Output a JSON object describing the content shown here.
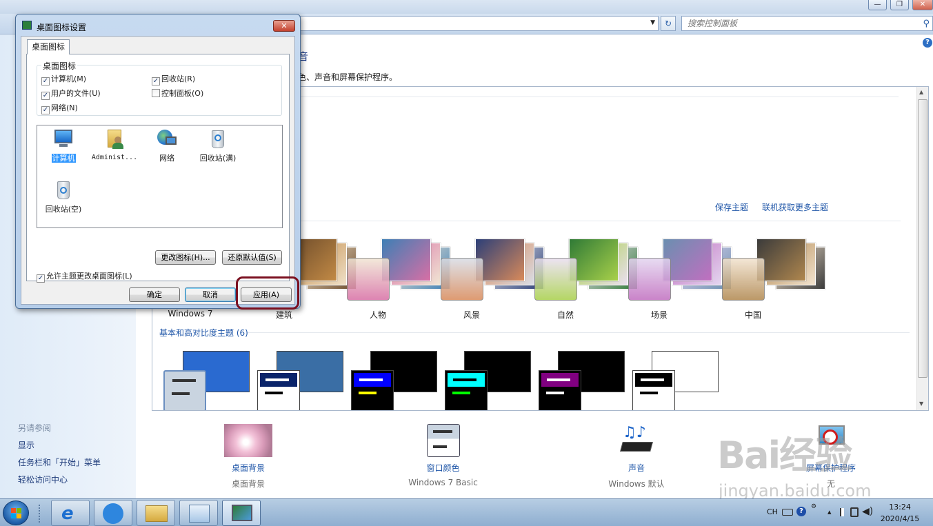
{
  "window": {
    "minimize_glyph": "—",
    "restore_glyph": "❐",
    "close_glyph": "✕",
    "address_dropdown_glyph": "▼",
    "refresh_glyph": "↻",
    "search_placeholder": "搜索控制面板",
    "search_glyph": "⚲",
    "help_glyph": "?"
  },
  "content": {
    "heading_tail": "音",
    "description_tail": "色、声音和屏幕保护程序。",
    "save_theme": "保存主题",
    "get_more_themes": "联机获取更多主题",
    "aero_themes": [
      {
        "name": "Windows 7",
        "colors": [
          "#1d6fd2",
          "#6fb2ef",
          "#dfe9f7"
        ]
      },
      {
        "name": "建筑",
        "colors": [
          "#6b4a2a",
          "#c28a45",
          "#efe0c8"
        ]
      },
      {
        "name": "人物",
        "colors": [
          "#3d7fb5",
          "#d86fa5",
          "#f1e6d4"
        ]
      },
      {
        "name": "风景",
        "colors": [
          "#2c3f78",
          "#d98a5a",
          "#d9dde6"
        ]
      },
      {
        "name": "自然",
        "colors": [
          "#2f7a36",
          "#a8d04a",
          "#eadff0"
        ]
      },
      {
        "name": "场景",
        "colors": [
          "#6a8fb0",
          "#c16fc0",
          "#e4d6f0"
        ]
      },
      {
        "name": "中国",
        "colors": [
          "#3b3b3b",
          "#b0874e",
          "#f2e3cf"
        ]
      }
    ],
    "basic_title": "基本和高对比度主题 (6)",
    "basic_themes": [
      {
        "big": "#2a6ad0",
        "cap": "#c9d4e0",
        "bar1": "#333333",
        "bar2": "#333333",
        "body": "#ffffff",
        "selected": true
      },
      {
        "big": "#3a6ea5",
        "cap": "#0a246a",
        "bar1": "#ffffff",
        "bar2": "#000000",
        "body": "#ffffff",
        "selected": false
      },
      {
        "big": "#000000",
        "cap": "#0000ff",
        "bar1": "#ffffff",
        "bar2": "#ffff00",
        "body": "#000000",
        "selected": false
      },
      {
        "big": "#000000",
        "cap": "#00ffff",
        "bar1": "#000000",
        "bar2": "#00ff00",
        "body": "#000000",
        "selected": false
      },
      {
        "big": "#000000",
        "cap": "#800080",
        "bar1": "#ffffff",
        "bar2": "#ffffff",
        "body": "#000000",
        "selected": false
      },
      {
        "big": "#ffffff",
        "cap": "#000000",
        "bar1": "#ffffff",
        "bar2": "#000000",
        "body": "#ffffff",
        "selected": false
      }
    ]
  },
  "sidebar": {
    "see_also": "另请参阅",
    "links": [
      "显示",
      "任务栏和「开始」菜单",
      "轻松访问中心"
    ]
  },
  "bottom": [
    {
      "label": "桌面背景",
      "sub": "桌面背景",
      "icon": "desktop-background-icon"
    },
    {
      "label": "窗口颜色",
      "sub": "Windows 7 Basic",
      "icon": "window-color-icon"
    },
    {
      "label": "声音",
      "sub": "Windows 默认",
      "icon": "sound-icon"
    },
    {
      "label": "屏幕保护程序",
      "sub": "无",
      "icon": "screensaver-icon"
    }
  ],
  "dialog": {
    "title": "桌面图标设置",
    "close_glyph": "✕",
    "tab": "桌面图标",
    "group_title": "桌面图标",
    "checkboxes": [
      {
        "label": "计算机(M)",
        "checked": true
      },
      {
        "label": "回收站(R)",
        "checked": true
      },
      {
        "label": "用户的文件(U)",
        "checked": true
      },
      {
        "label": "控制面板(O)",
        "checked": false
      },
      {
        "label": "网络(N)",
        "checked": true
      }
    ],
    "check_glyph": "✓",
    "icons": [
      {
        "label": "计算机",
        "icon": "computer-icon",
        "selected": true
      },
      {
        "label": "Administ...",
        "icon": "user-folder-icon",
        "selected": false
      },
      {
        "label": "网络",
        "icon": "network-icon",
        "selected": false
      },
      {
        "label": "回收站(满)",
        "icon": "recycle-bin-full-icon",
        "selected": false
      },
      {
        "label": "回收站(空)",
        "icon": "recycle-bin-empty-icon",
        "selected": false
      }
    ],
    "change_icon": "更改图标(H)...",
    "restore_default": "还原默认值(S)",
    "allow_themes": "允许主题更改桌面图标(L)",
    "allow_themes_checked": true,
    "ok": "确定",
    "cancel": "取消",
    "apply": "应用(A)"
  },
  "taskbar": {
    "apps": [
      "internet-explorer-icon",
      "feishu-icon",
      "file-explorer-icon",
      "control-panel-icon",
      "desktop-icon-settings-icon"
    ],
    "tray_lang": "CH",
    "tray_help": "?",
    "tray_chevron": "▴",
    "time": "13:24",
    "date": "2020/4/15"
  },
  "watermark": {
    "logo": "Bai经验",
    "url": "jingyan.baidu.com"
  }
}
